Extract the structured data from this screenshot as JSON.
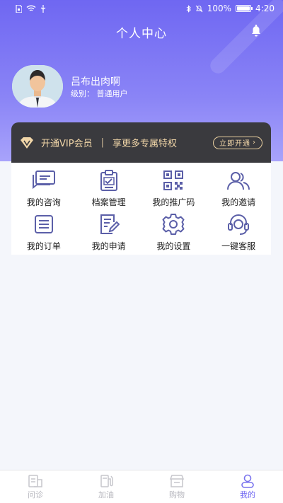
{
  "status_bar": {
    "battery": "100%",
    "time": "4:20"
  },
  "header": {
    "title": "个人中心"
  },
  "user": {
    "name": "吕布出肉啊",
    "level": "级别：  普通用户"
  },
  "vip": {
    "text": "开通VIP会员",
    "separator": "|",
    "subtext": "享更多专属特权",
    "button_label": "立即开通",
    "button_arrow": "›"
  },
  "menu": [
    {
      "label": "我的咨询",
      "icon": "chat-icon"
    },
    {
      "label": "档案管理",
      "icon": "clipboard-check-icon"
    },
    {
      "label": "我的推广码",
      "icon": "qrcode-icon"
    },
    {
      "label": "我的邀请",
      "icon": "users-icon"
    },
    {
      "label": "我的订单",
      "icon": "order-list-icon"
    },
    {
      "label": "我的申请",
      "icon": "edit-document-icon"
    },
    {
      "label": "我的设置",
      "icon": "gear-icon"
    },
    {
      "label": "一键客服",
      "icon": "headset-icon"
    }
  ],
  "tabbar": [
    {
      "label": "问诊",
      "icon": "consult-icon",
      "active": false
    },
    {
      "label": "加油",
      "icon": "fuel-icon",
      "active": false
    },
    {
      "label": "购物",
      "icon": "shop-icon",
      "active": false
    },
    {
      "label": "我的",
      "icon": "profile-icon",
      "active": true
    }
  ],
  "colors": {
    "accent": "#6f67f2",
    "vip_gold": "#f1d6a8",
    "vip_bg": "#3a3a3e",
    "icon_purple": "#5b5fa8"
  }
}
